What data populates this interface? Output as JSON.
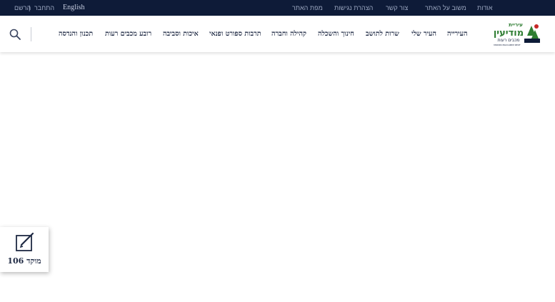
{
  "topbar": {
    "links": [
      "אודות",
      "משוב על האתר",
      "צור קשר",
      "הצהרת נגישות",
      "מפת האתר"
    ],
    "login": "התחבר",
    "separator": "|",
    "register": "הרשם",
    "language": "English"
  },
  "header": {
    "logo": {
      "line1": "עיריית",
      "line2": "מודיעין",
      "line3": "מכבים רעות",
      "line4": "MODIIN MACCABIM REUT",
      "colors": {
        "green": "#2e7d32",
        "red": "#c62828",
        "navy": "#0e1b38"
      }
    },
    "nav": [
      "העירייה",
      "העיר שלי",
      "שרות לתושב",
      "חינוך והשכלה",
      "קהילה וחברה",
      "תרבות ספורט ופנאי",
      "איכות וסביבה",
      "רובע מכבים רעות",
      "תכנון והנדסה"
    ],
    "search_icon": "search-icon"
  },
  "hotline": {
    "label": "מוקד 106",
    "icon": "edit-note-icon"
  }
}
